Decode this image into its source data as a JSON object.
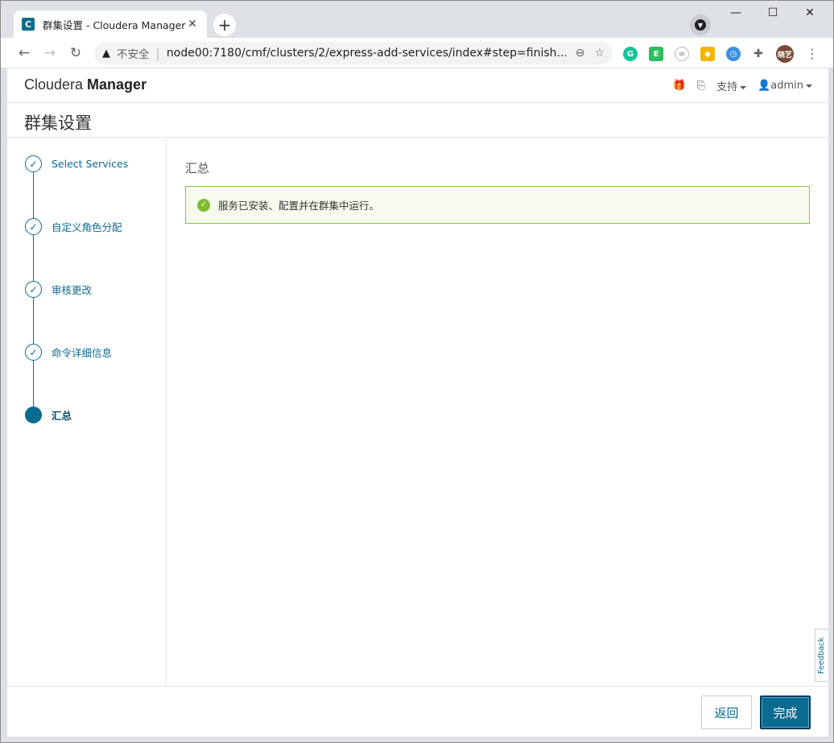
{
  "browser": {
    "tab_title": "群集设置 - Cloudera Manager",
    "tab_favicon_letter": "C",
    "security_label": "不安全",
    "url": "node00:7180/cmf/clusters/2/express-add-services/index#step=finish...",
    "profile_label": "晓艺",
    "extension_icons": [
      "grammarly-icon",
      "evernote-icon",
      "link-icon",
      "scooter-icon",
      "clock-icon",
      "puzzle-icon"
    ]
  },
  "header": {
    "brand_light": "Cloudera ",
    "brand_bold": "Manager",
    "support_label": "支持",
    "user_label": "admin"
  },
  "page": {
    "title": "群集设置"
  },
  "steps": [
    {
      "label": "Select Services",
      "state": "done"
    },
    {
      "label": "自定义角色分配",
      "state": "done"
    },
    {
      "label": "审核更改",
      "state": "done"
    },
    {
      "label": "命令详细信息",
      "state": "done"
    },
    {
      "label": "汇总",
      "state": "current"
    }
  ],
  "main": {
    "section_title": "汇总",
    "alert_text": "服务已安装、配置并在群集中运行。"
  },
  "feedback_label": "Feedback",
  "footer": {
    "back_label": "返回",
    "finish_label": "完成"
  },
  "colors": {
    "accent": "#0b6c91",
    "success": "#7dbb2f",
    "alert_bg": "#f6fbee"
  }
}
